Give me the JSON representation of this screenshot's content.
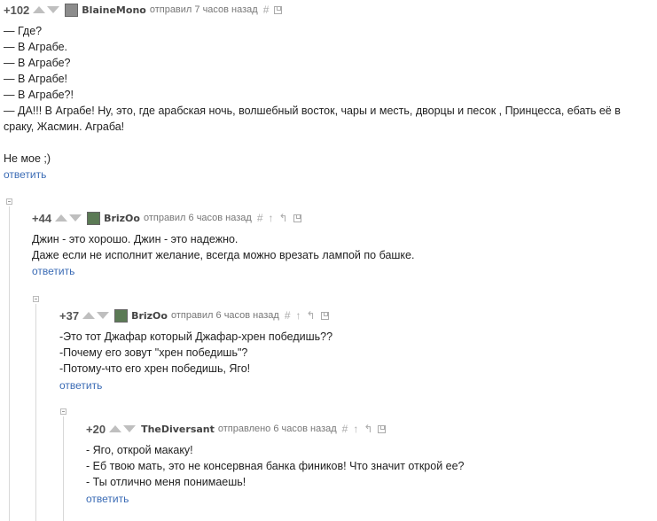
{
  "comments": [
    {
      "rating": "+102",
      "author": "BlaineMono",
      "meta": "отправил 7 часов назад",
      "lines": [
        "— Где?",
        "— В Аграбе.",
        "— В Аграбе?",
        "— В Аграбе!",
        "— В Аграбе?!",
        "— ДА!!! В Аграбе! Ну, это, где арабская ночь, волшебный восток, чары и месть, дворцы и песок , Принцесса, ебать её в",
        "сраку, Жасмин. Аграба!",
        "",
        "Не мое ;)"
      ],
      "reply": "ответить"
    },
    {
      "rating": "+44",
      "author": "BrizOo",
      "meta": "отправил 6 часов назад",
      "lines": [
        "Джин - это хорошо. Джин - это надежно.",
        "Даже если не исполнит желание, всегда можно врезать лампой по башке."
      ],
      "reply": "ответить"
    },
    {
      "rating": "+37",
      "author": "BrizOo",
      "meta": "отправил 6 часов назад",
      "lines": [
        "-Это тот Джафар который Джафар-хрен победишь??",
        "-Почему его зовут \"хрен победишь\"?",
        "-Потому-что его хрен победишь, Яго!"
      ],
      "reply": "ответить"
    },
    {
      "rating": "+20",
      "author": "TheDiversant",
      "meta": "отправлено 6 часов назад",
      "lines": [
        "- Яго, открой макаку!",
        "- Еб твою мать, это не консервная банка фиников! Что значит открой ее?",
        "- Ты отлично меня понимаешь!"
      ],
      "reply": "ответить"
    }
  ],
  "icons": {
    "hash": "#",
    "up": "↑",
    "parent": "↰"
  }
}
